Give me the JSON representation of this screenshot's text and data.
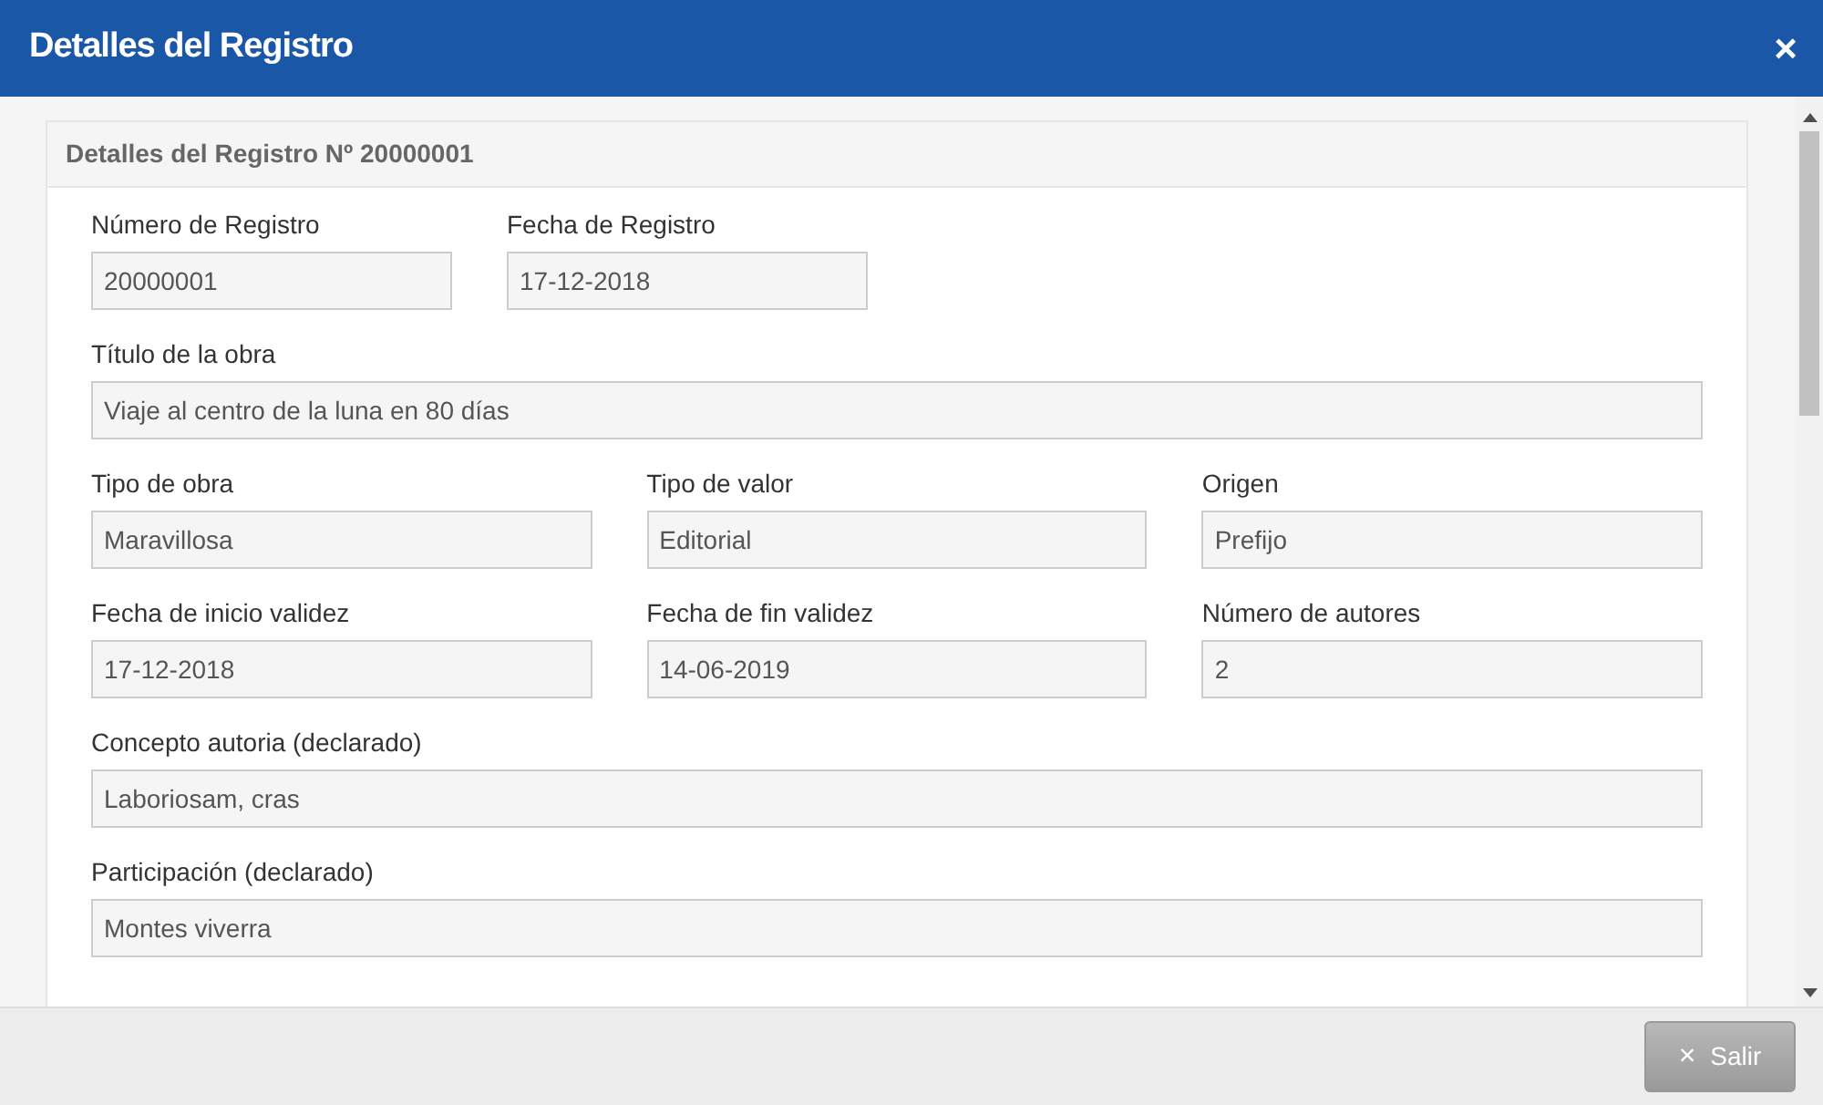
{
  "window": {
    "title": "Detalles del Registro",
    "close": "×"
  },
  "panel": {
    "heading": "Detalles del Registro Nº 20000001",
    "rows": [
      {
        "kind": "pair",
        "fields": [
          {
            "label": "Número de Registro",
            "value": "20000001"
          },
          {
            "label": "Fecha de Registro",
            "value": "17-12-2018"
          }
        ]
      },
      {
        "kind": "full",
        "fields": [
          {
            "label": "Título de la obra",
            "value": "Viaje al centro de la luna en 80 días"
          }
        ]
      },
      {
        "kind": "triple",
        "fields": [
          {
            "label": "Tipo de obra",
            "value": "Maravillosa"
          },
          {
            "label": "Tipo de valor",
            "value": "Editorial"
          },
          {
            "label": "Origen",
            "value": "Prefijo"
          }
        ]
      },
      {
        "kind": "triple",
        "fields": [
          {
            "label": "Fecha de inicio validez",
            "value": "17-12-2018"
          },
          {
            "label": "Fecha de fin validez",
            "value": "14-06-2019"
          },
          {
            "label": "Número de autores",
            "value": "2"
          }
        ]
      },
      {
        "kind": "full",
        "fields": [
          {
            "label": "Concepto autoria (declarado)",
            "value": "Laboriosam, cras"
          }
        ]
      },
      {
        "kind": "full",
        "fields": [
          {
            "label": "Participación (declarado)",
            "value": "Montes viverra"
          }
        ]
      }
    ]
  },
  "footer": {
    "button": {
      "icon": "×",
      "label": "Salir"
    }
  }
}
